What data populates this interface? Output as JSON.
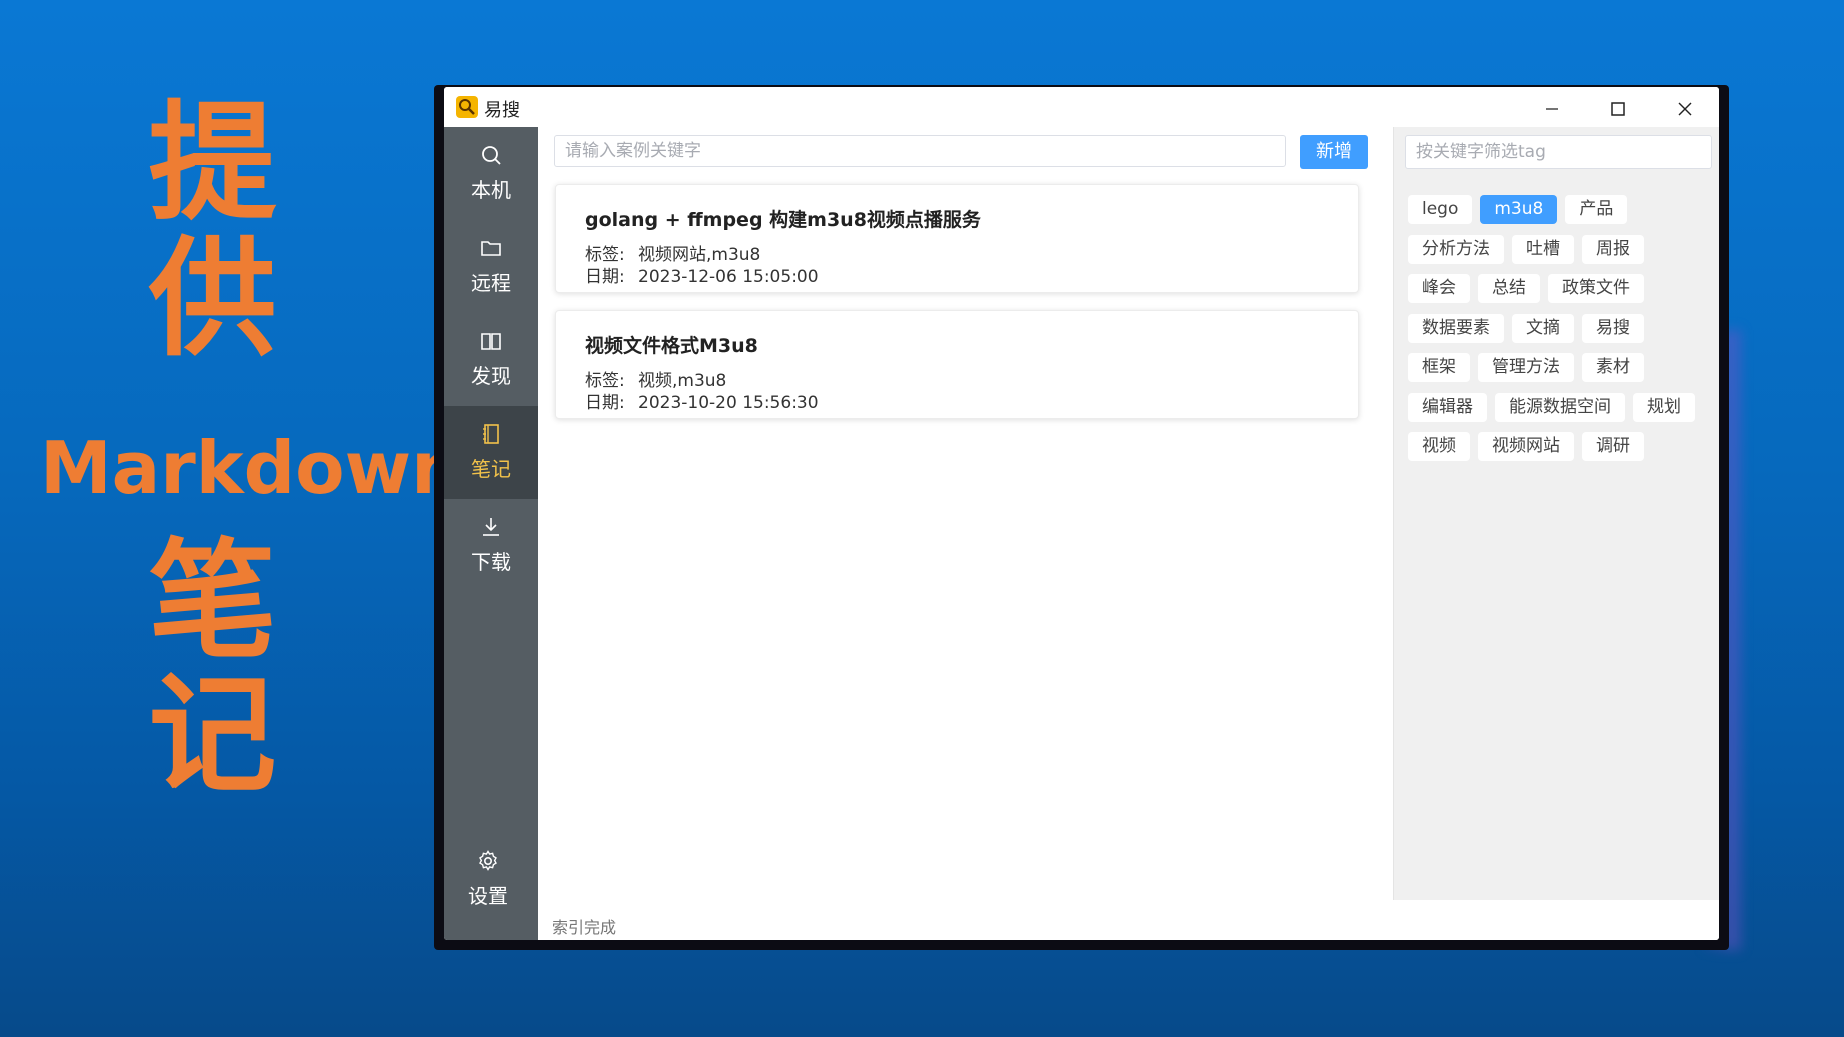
{
  "promo": {
    "line1": "提",
    "line2": "供",
    "line3": "Markdown",
    "line4": "笔",
    "line5": "记"
  },
  "window": {
    "title": "易搜",
    "logo_icon": "magnifier-logo-icon",
    "controls": [
      "minimize-icon",
      "maximize-icon",
      "close-icon"
    ]
  },
  "sidebar": {
    "items": [
      {
        "label": "本机",
        "icon": "search-icon"
      },
      {
        "label": "远程",
        "icon": "folder-icon"
      },
      {
        "label": "发现",
        "icon": "book-open-icon"
      },
      {
        "label": "笔记",
        "icon": "notebook-icon",
        "active": true
      },
      {
        "label": "下载",
        "icon": "download-icon"
      }
    ],
    "settings": {
      "label": "设置",
      "icon": "gear-icon"
    }
  },
  "main": {
    "search_placeholder": "请输入案例关键字",
    "add_label": "新增",
    "field_tags": "标签:",
    "field_date": "日期:",
    "notes": [
      {
        "title": "golang + ffmpeg 构建m3u8视频点播服务",
        "tags": "视频网站,m3u8",
        "date": "2023-12-06 15:05:00"
      },
      {
        "title": "视频文件格式M3u8",
        "tags": "视频,m3u8",
        "date": "2023-10-20 15:56:30"
      }
    ]
  },
  "tagpanel": {
    "filter_placeholder": "按关键字筛选tag",
    "selected": "m3u8",
    "rows": [
      [
        "lego",
        "m3u8",
        "产品"
      ],
      [
        "分析方法",
        "吐槽",
        "周报"
      ],
      [
        "峰会",
        "总结",
        "政策文件"
      ],
      [
        "数据要素",
        "文摘",
        "易搜"
      ],
      [
        "框架",
        "管理方法",
        "素材"
      ],
      [
        "编辑器",
        "能源数据空间",
        "规划"
      ],
      [
        "视频",
        "视频网站",
        "调研"
      ]
    ]
  },
  "status": {
    "text": "索引完成"
  },
  "colors": {
    "accent": "#409eff",
    "sidebar": "#555d63",
    "sidebar_active": "#3d4449",
    "active_text": "#f2c24a",
    "promo": "#ee7d33"
  }
}
